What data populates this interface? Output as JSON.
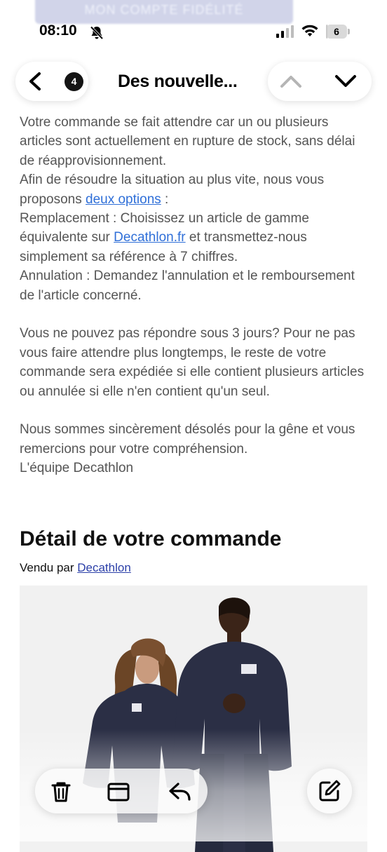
{
  "top_banner": {
    "label": "MON COMPTE FIDÉLITÉ"
  },
  "status_bar": {
    "time": "08:10",
    "battery": "6",
    "battery_level": 0.06
  },
  "nav": {
    "unread_count": "4",
    "title": "Des nouvelle..."
  },
  "email": {
    "p1": "Votre commande se fait attendre car un ou plusieurs articles sont actuellement en rupture de stock, sans délai de réapprovisionnement.",
    "p2_before": "Afin de résoudre la situation au plus vite, nous vous proposons ",
    "p2_link": "deux options",
    "p2_after": " :",
    "p3_before": "Remplacement : Choisissez un article de gamme équivalente sur ",
    "p3_link": "Decathlon.fr",
    "p3_after": " et transmettez-nous simplement sa référence à 7 chiffres.",
    "p4": "Annulation : Demandez l'annulation et le remboursement de l'article concerné.",
    "p5": "Vous ne pouvez pas répondre sous 3 jours? Pour ne pas vous faire attendre plus longtemps, le reste de votre commande sera expédiée si elle contient plusieurs articles ou annulée si elle n'en contient qu'un seul.",
    "p6": "Nous sommes sincèrement désolés pour la gêne et vous remercions pour votre compréhension.",
    "p7": "L'équipe Decathlon"
  },
  "order": {
    "section_title": "Détail de votre commande",
    "sold_by_label": "Vendu par ",
    "seller_link": "Decathlon"
  },
  "toolbar": {
    "icons": [
      "trash-icon",
      "folder-icon",
      "reply-icon",
      "compose-icon"
    ]
  },
  "colors": {
    "link": "#2f6fd8",
    "body_text": "#555555",
    "jacket": "#2b2f45"
  }
}
